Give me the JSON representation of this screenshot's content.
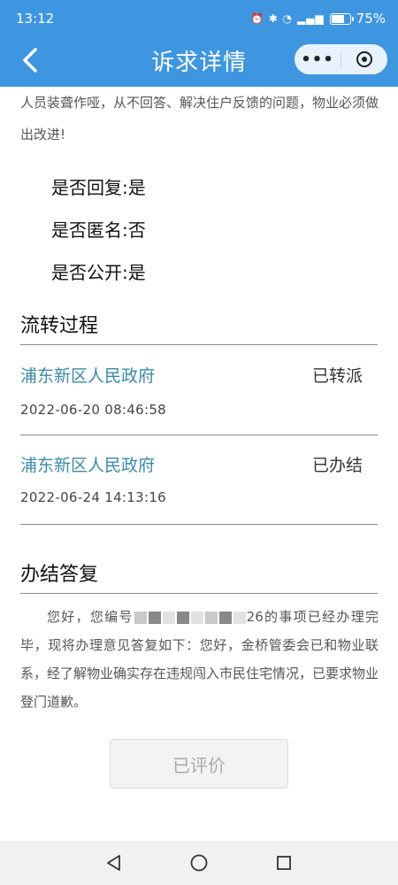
{
  "status_bar": {
    "time": "13:12",
    "battery_percent": "75%",
    "battery_level": 0.75
  },
  "header": {
    "title": "诉求详情",
    "more_label": "•••"
  },
  "description_tail": "人员装聋作哑，从不回答、解决住户反馈的问题，物业必须做出改进!",
  "meta": {
    "replied": "是否回复:是",
    "anonymous": "是否匿名:否",
    "public": "是否公开:是"
  },
  "flow": {
    "title": "流转过程",
    "items": [
      {
        "org": "浦东新区人民政府",
        "status": "已转派",
        "time": "2022-06-20 08:46:58"
      },
      {
        "org": "浦东新区人民政府",
        "status": "已办结",
        "time": "2022-06-24 14:13:16"
      }
    ]
  },
  "reply": {
    "title": "办结答复",
    "text_prefix": "您好，您编号",
    "text_suffix": "26的事项已经办理完毕，现将办理意见答复如下：您好，金桥管委会已和物业联系，经了解物业确实存在违规闯入市民住宅情况，已要求物业登门道歉。"
  },
  "rated_button": "已评价",
  "colors": {
    "header_bg": "#3f96e0",
    "link": "#3a8aaa"
  }
}
